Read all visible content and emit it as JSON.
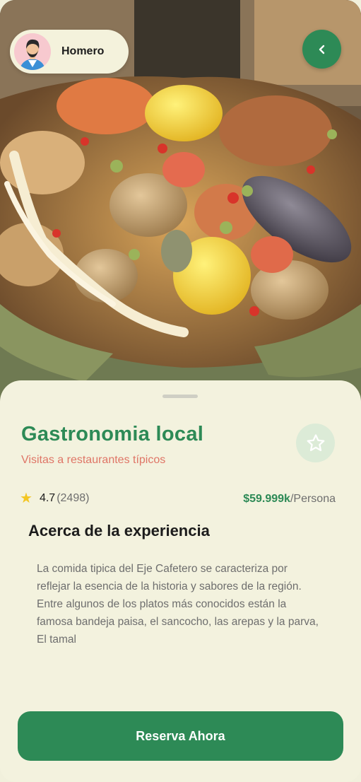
{
  "user": {
    "name": "Homero"
  },
  "experience": {
    "title": "Gastronomia local",
    "subtitle": "Visitas a restaurantes típicos",
    "rating": "4.7",
    "reviews": "(2498)",
    "price": "$59.999k",
    "price_unit": "/Persona"
  },
  "about": {
    "heading": "Acerca de la experiencia",
    "text": "La comida tipica del Eje Cafetero se caracteriza por reflejar la esencia de la historia y sabores de la región. Entre algunos de los platos más conocidos están la famosa bandeja paisa, el sancocho, las arepas y la parva, El tamal"
  },
  "cta": {
    "label": "Reserva Ahora"
  },
  "icons": {
    "back": "chevron-left-icon",
    "favorite": "star-outline-icon",
    "rating": "star-filled-icon"
  },
  "colors": {
    "primary": "#2d8a56",
    "accent": "#df7566",
    "background": "#f3f2de",
    "star": "#f3c623"
  }
}
